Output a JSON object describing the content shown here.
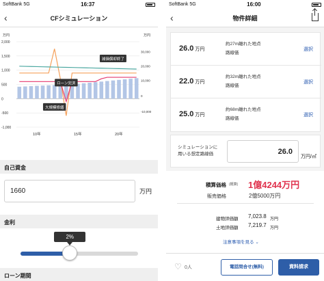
{
  "left": {
    "status": {
      "carrier": "SoftBank",
      "network": "5G",
      "time": "16:37"
    },
    "nav": {
      "back": "‹",
      "title": "CFシミュレーション"
    },
    "chart_data": {
      "type": "bar+line",
      "left_unit": "万円",
      "right_unit": "万円",
      "y_left_ticks": [
        "2,000",
        "1,500",
        "1,000",
        "500",
        "0",
        "-500",
        "-1,000"
      ],
      "y_right_ticks": [
        "30,000",
        "20,000",
        "10,000",
        "0",
        "-10,000"
      ],
      "x_ticks": [
        "10年",
        "15年",
        "20年"
      ],
      "series": [
        {
          "kind": "bar",
          "color": "#b3c6e6",
          "values": [
            420,
            430,
            440,
            450,
            460,
            470,
            480,
            490,
            500,
            510,
            520,
            540,
            560,
            580,
            600,
            620,
            640,
            660,
            680,
            700,
            720
          ]
        },
        {
          "kind": "line",
          "color": "#f5a05a",
          "values": [
            900,
            900,
            900,
            900,
            900,
            900,
            1750,
            700,
            -600,
            900,
            900,
            900,
            900,
            900,
            900,
            900,
            900,
            900,
            900,
            900,
            900
          ]
        },
        {
          "kind": "line",
          "color": "#e53a6e",
          "values": [
            600,
            600,
            600,
            600,
            600,
            600,
            600,
            600,
            -100,
            600,
            600,
            600,
            600,
            600,
            700,
            750,
            750,
            750,
            750,
            750,
            750
          ]
        },
        {
          "kind": "line",
          "color": "#4aa7a0",
          "values": [
            1140,
            1135,
            1130,
            1125,
            1120,
            1115,
            1110,
            1105,
            1100,
            1095,
            1090,
            1085,
            1080,
            1075,
            1070,
            1065,
            1060,
            1055,
            1050,
            1045,
            1040
          ]
        }
      ],
      "annotations": [
        "減価償却終了",
        "ローン完済",
        "大規模修繕"
      ]
    },
    "own_funds": {
      "label": "自己資金",
      "value": "1660",
      "unit": "万円"
    },
    "interest": {
      "label": "金利",
      "value": "2%",
      "fraction": 0.42
    },
    "loan_period": {
      "label": "ローン期間"
    }
  },
  "right": {
    "status": {
      "carrier": "SoftBank",
      "network": "5G",
      "time": "16:00"
    },
    "nav": {
      "back": "‹",
      "title": "物件詳細"
    },
    "rows": [
      {
        "price": "26.0",
        "unit": "万円",
        "distance": "約27m離れた地点",
        "type": "路線価",
        "action": "選択"
      },
      {
        "price": "22.0",
        "unit": "万円",
        "distance": "約32m離れた地点",
        "type": "路線価",
        "action": "選択"
      },
      {
        "price": "25.0",
        "unit": "万円",
        "distance": "約68m離れた地点",
        "type": "路線価",
        "action": "選択"
      }
    ],
    "simulation": {
      "label_line1": "シミュレーションに",
      "label_line2": "用いる想定路線価",
      "value": "26.0",
      "unit": "万円/㎡"
    },
    "estimate": {
      "label": "積算価格",
      "note": "(概算)",
      "value": "1億4244万円"
    },
    "sale": {
      "label": "販売価格",
      "value": "2億5000万円"
    },
    "building": {
      "label": "建物評価額",
      "value": "7,023.8",
      "unit": "万円"
    },
    "land": {
      "label": "土地評価額",
      "value": "7,219.7",
      "unit": "万円"
    },
    "notice": {
      "label": "注意事項を見る"
    },
    "footer": {
      "likes": "0人",
      "phone": "電話問合せ(無料)",
      "request": "資料請求"
    }
  }
}
